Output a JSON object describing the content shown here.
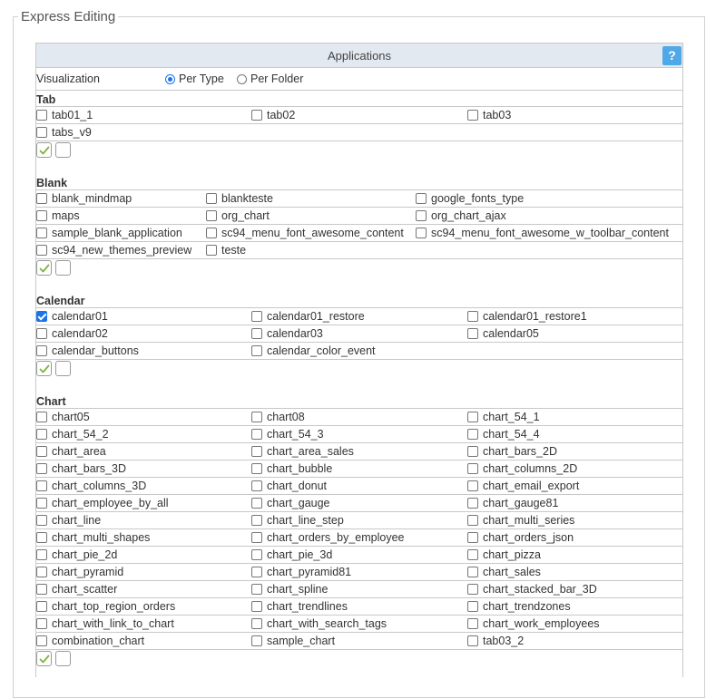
{
  "fieldset": {
    "legend": "Express Editing"
  },
  "header": {
    "title": "Applications",
    "help_label": "?"
  },
  "visualization": {
    "label": "Visualization",
    "options": [
      {
        "label": "Per Type",
        "checked": true
      },
      {
        "label": "Per Folder",
        "checked": false
      }
    ]
  },
  "sections": [
    {
      "title": "Tab",
      "columns": 3,
      "items": [
        {
          "label": "tab01_1",
          "checked": false
        },
        {
          "label": "tab02",
          "checked": false
        },
        {
          "label": "tab03",
          "checked": false
        },
        {
          "label": "tabs_v9",
          "checked": false
        }
      ]
    },
    {
      "title": "Blank",
      "columns": 3,
      "col_offsets": "blank",
      "items": [
        {
          "label": "blank_mindmap",
          "checked": false
        },
        {
          "label": "blankteste",
          "checked": false
        },
        {
          "label": "google_fonts_type",
          "checked": false
        },
        {
          "label": "maps",
          "checked": false
        },
        {
          "label": "org_chart",
          "checked": false
        },
        {
          "label": "org_chart_ajax",
          "checked": false
        },
        {
          "label": "sample_blank_application",
          "checked": false
        },
        {
          "label": "sc94_menu_font_awesome_content",
          "checked": false
        },
        {
          "label": "sc94_menu_font_awesome_w_toolbar_content",
          "checked": false
        },
        {
          "label": "sc94_new_themes_preview",
          "checked": false
        },
        {
          "label": "teste",
          "checked": false
        }
      ]
    },
    {
      "title": "Calendar",
      "columns": 3,
      "items": [
        {
          "label": "calendar01",
          "checked": true
        },
        {
          "label": "calendar01_restore",
          "checked": false
        },
        {
          "label": "calendar01_restore1",
          "checked": false
        },
        {
          "label": "calendar02",
          "checked": false
        },
        {
          "label": "calendar03",
          "checked": false
        },
        {
          "label": "calendar05",
          "checked": false
        },
        {
          "label": "calendar_buttons",
          "checked": false
        },
        {
          "label": "calendar_color_event",
          "checked": false
        }
      ]
    },
    {
      "title": "Chart",
      "columns": 3,
      "items": [
        {
          "label": "chart05",
          "checked": false
        },
        {
          "label": "chart08",
          "checked": false
        },
        {
          "label": "chart_54_1",
          "checked": false
        },
        {
          "label": "chart_54_2",
          "checked": false
        },
        {
          "label": "chart_54_3",
          "checked": false
        },
        {
          "label": "chart_54_4",
          "checked": false
        },
        {
          "label": "chart_area",
          "checked": false
        },
        {
          "label": "chart_area_sales",
          "checked": false
        },
        {
          "label": "chart_bars_2D",
          "checked": false
        },
        {
          "label": "chart_bars_3D",
          "checked": false
        },
        {
          "label": "chart_bubble",
          "checked": false
        },
        {
          "label": "chart_columns_2D",
          "checked": false
        },
        {
          "label": "chart_columns_3D",
          "checked": false
        },
        {
          "label": "chart_donut",
          "checked": false
        },
        {
          "label": "chart_email_export",
          "checked": false
        },
        {
          "label": "chart_employee_by_all",
          "checked": false
        },
        {
          "label": "chart_gauge",
          "checked": false
        },
        {
          "label": "chart_gauge81",
          "checked": false
        },
        {
          "label": "chart_line",
          "checked": false
        },
        {
          "label": "chart_line_step",
          "checked": false
        },
        {
          "label": "chart_multi_series",
          "checked": false
        },
        {
          "label": "chart_multi_shapes",
          "checked": false
        },
        {
          "label": "chart_orders_by_employee",
          "checked": false
        },
        {
          "label": "chart_orders_json",
          "checked": false
        },
        {
          "label": "chart_pie_2d",
          "checked": false
        },
        {
          "label": "chart_pie_3d",
          "checked": false
        },
        {
          "label": "chart_pizza",
          "checked": false
        },
        {
          "label": "chart_pyramid",
          "checked": false
        },
        {
          "label": "chart_pyramid81",
          "checked": false
        },
        {
          "label": "chart_sales",
          "checked": false
        },
        {
          "label": "chart_scatter",
          "checked": false
        },
        {
          "label": "chart_spline",
          "checked": false
        },
        {
          "label": "chart_stacked_bar_3D",
          "checked": false
        },
        {
          "label": "chart_top_region_orders",
          "checked": false
        },
        {
          "label": "chart_trendlines",
          "checked": false
        },
        {
          "label": "chart_trendzones",
          "checked": false
        },
        {
          "label": "chart_with_link_to_chart",
          "checked": false
        },
        {
          "label": "chart_with_search_tags",
          "checked": false
        },
        {
          "label": "chart_work_employees",
          "checked": false
        },
        {
          "label": "combination_chart",
          "checked": false
        },
        {
          "label": "sample_chart",
          "checked": false
        },
        {
          "label": "tab03_2",
          "checked": false
        }
      ]
    }
  ],
  "colors": {
    "accent": "#1a73e8",
    "help": "#4fa8e8",
    "header_bg": "#e3e9f0",
    "check_green": "#7cb342"
  }
}
